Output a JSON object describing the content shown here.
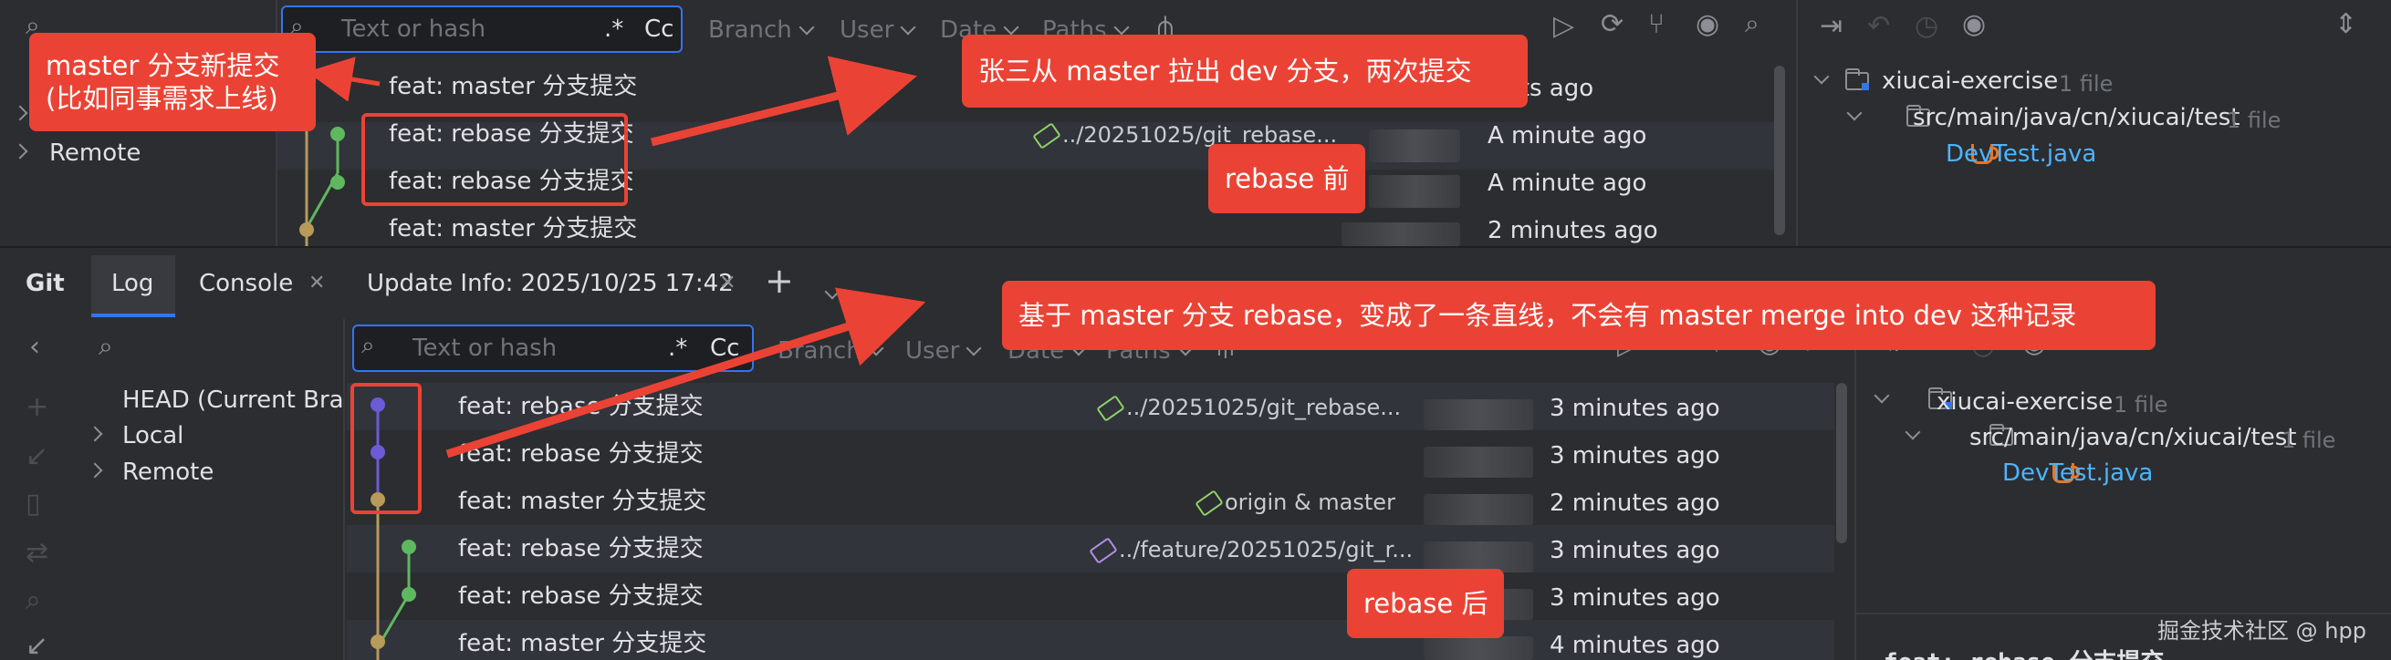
{
  "top": {
    "search_placeholder": "Text or hash",
    "regex": ".*",
    "case": "Cc",
    "filters": [
      "Branch",
      "User",
      "Date",
      "Paths"
    ],
    "sidebar": {
      "remote": "Remote"
    },
    "commits": [
      {
        "msg": "feat: master 分支提交",
        "ref": "",
        "time": "ments ago"
      },
      {
        "msg": "feat: rebase 分支提交",
        "ref": "../20251025/git_rebase...",
        "time": "A minute ago"
      },
      {
        "msg": "feat: rebase 分支提交",
        "ref": "",
        "time": "A minute ago"
      },
      {
        "msg": "feat: master 分支提交",
        "ref": "",
        "time": "2 minutes ago"
      }
    ],
    "tree": {
      "project": "xiucai-exercise",
      "project_count": "1 file",
      "path": "src/main/java/cn/xiucai/test",
      "path_count": "1 file",
      "file": "DevTest.java"
    }
  },
  "tabs": {
    "git": "Git",
    "log": "Log",
    "console": "Console",
    "update": "Update Info: 2025/10/25 17:42",
    "plus": "+"
  },
  "bottom": {
    "search_placeholder": "Text or hash",
    "regex": ".*",
    "case": "Cc",
    "filters": [
      "Branch",
      "User",
      "Date",
      "Paths"
    ],
    "sidebar": {
      "head": "HEAD (Current Bran",
      "local": "Local",
      "remote": "Remote"
    },
    "commits": [
      {
        "msg": "feat: rebase 分支提交",
        "ref": "../20251025/git_rebase...",
        "time": "3 minutes ago"
      },
      {
        "msg": "feat: rebase 分支提交",
        "ref": "",
        "time": "3 minutes ago"
      },
      {
        "msg": "feat: master 分支提交",
        "ref": "origin & master",
        "time": "2 minutes ago"
      },
      {
        "msg": "feat: rebase 分支提交",
        "ref": "../feature/20251025/git_r...",
        "time": "3 minutes ago"
      },
      {
        "msg": "feat: rebase 分支提交",
        "ref": "",
        "time": "3 minutes ago"
      },
      {
        "msg": "feat: master 分支提交",
        "ref": "",
        "time": "4 minutes ago"
      }
    ],
    "tree": {
      "project": "xiucai-exercise",
      "project_count": "1 file",
      "path": "src/main/java/cn/xiucai/test",
      "path_count": "1 file",
      "file": "DevTest.java"
    },
    "detail_peek": "feat: rebase 分支提交"
  },
  "annotations": {
    "master_new_commit_1": "master 分支新提交",
    "master_new_commit_2": "(比如同事需求上线)",
    "zhangsan": "张三从 master 拉出 dev 分支，两次提交",
    "before": "rebase 前",
    "based_on": "基于 master 分支 rebase，变成了一条直线，不会有 master merge into dev 这种记录",
    "after": "rebase 后"
  },
  "watermark": "掘金技术社区 @ hpp",
  "colors": {
    "annotation_red": "#ea4335",
    "accent_blue": "#3574f0",
    "graph_purple": "#6b5bd6",
    "graph_green": "#5fb85f",
    "graph_gold": "#b89a5a"
  }
}
